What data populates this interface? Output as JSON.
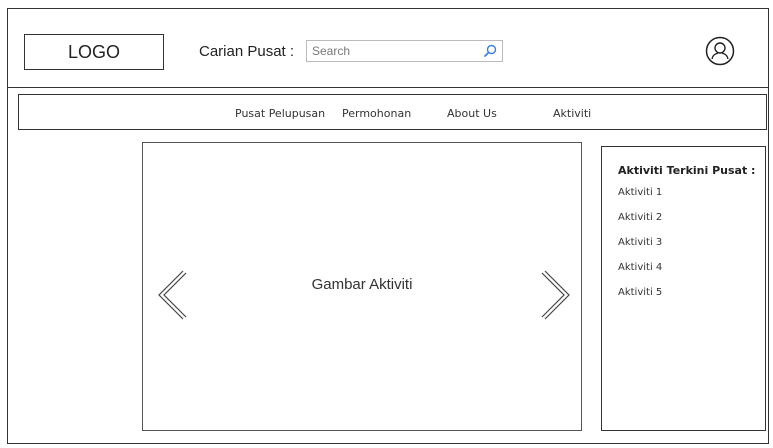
{
  "header": {
    "logo": "LOGO",
    "search_label": "Carian Pusat :",
    "search_placeholder": "Search",
    "search_icon": "search-icon",
    "user_icon": "user-profile-icon"
  },
  "nav": {
    "items": [
      {
        "label": "Pusat Pelupusan"
      },
      {
        "label": "Permohonan"
      },
      {
        "label": "About Us"
      },
      {
        "label": "Aktiviti"
      }
    ]
  },
  "carousel": {
    "caption": "Gambar Aktiviti",
    "prev_icon": "chevron-left-icon",
    "next_icon": "chevron-right-icon"
  },
  "sidebar": {
    "title": "Aktiviti Terkini Pusat :",
    "items": [
      {
        "label": "Aktiviti 1"
      },
      {
        "label": "Aktiviti 2"
      },
      {
        "label": "Aktiviti 3"
      },
      {
        "label": "Aktiviti 4"
      },
      {
        "label": "Aktiviti 5"
      }
    ]
  }
}
